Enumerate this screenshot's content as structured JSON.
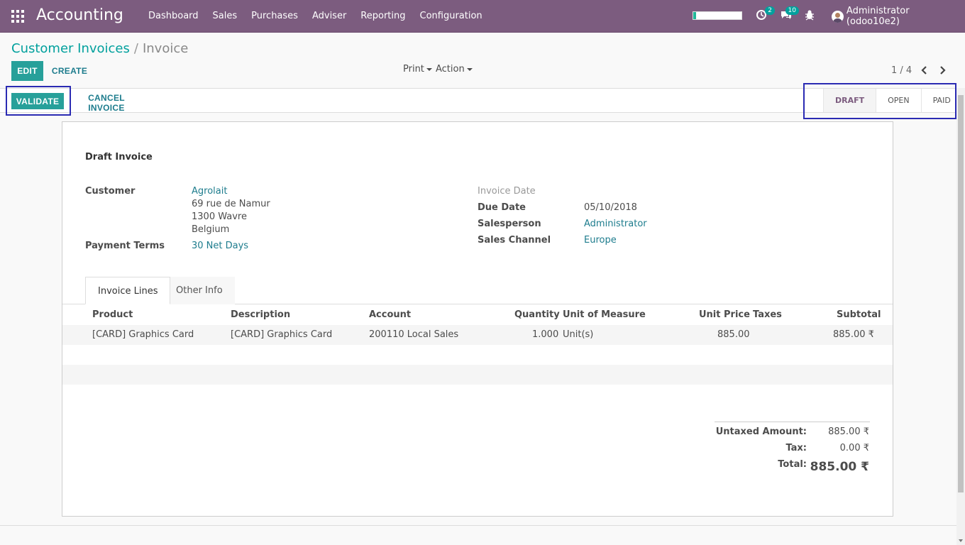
{
  "navbar": {
    "app_title": "Accounting",
    "menu": [
      "Dashboard",
      "Sales",
      "Purchases",
      "Adviser",
      "Reporting",
      "Configuration"
    ],
    "activity_count": "2",
    "messages_count": "10",
    "user": "Administrator (odoo10e2)"
  },
  "breadcrumb": {
    "parent": "Customer Invoices",
    "separator": "/",
    "current": "Invoice"
  },
  "toolbar": {
    "edit": "EDIT",
    "create": "CREATE",
    "print": "Print",
    "action": "Action",
    "pager": "1 / 4"
  },
  "statusbar": {
    "validate": "VALIDATE",
    "cancel": "CANCEL INVOICE",
    "stages": [
      "DRAFT",
      "OPEN",
      "PAID"
    ],
    "active_stage": "DRAFT"
  },
  "invoice": {
    "title": "Draft Invoice",
    "customer_label": "Customer",
    "customer_name": "Agrolait",
    "address": [
      "69 rue de Namur",
      "1300 Wavre",
      "Belgium"
    ],
    "payment_terms_label": "Payment Terms",
    "payment_terms": "30 Net Days",
    "invoice_date_label": "Invoice Date",
    "due_date_label": "Due Date",
    "due_date": "05/10/2018",
    "salesperson_label": "Salesperson",
    "salesperson": "Administrator",
    "sales_channel_label": "Sales Channel",
    "sales_channel": "Europe"
  },
  "tabs": [
    "Invoice Lines",
    "Other Info"
  ],
  "lines": {
    "headers": [
      "Product",
      "Description",
      "Account",
      "Quantity",
      "Unit of Measure",
      "Unit Price",
      "Taxes",
      "Subtotal"
    ],
    "rows": [
      [
        "[CARD] Graphics Card",
        "[CARD] Graphics Card",
        "200110 Local Sales",
        "1.000",
        "Unit(s)",
        "885.00",
        "",
        "885.00 ₹"
      ]
    ]
  },
  "totals": {
    "untaxed_label": "Untaxed Amount:",
    "untaxed": "885.00 ₹",
    "tax_label": "Tax:",
    "tax": "0.00 ₹",
    "total_label": "Total:",
    "total": "885.00 ₹"
  },
  "colors": {
    "navbar": "#7c5c7f",
    "primary": "#27a09a",
    "link": "#1d7c8d",
    "highlight": "#2b2bb3"
  }
}
